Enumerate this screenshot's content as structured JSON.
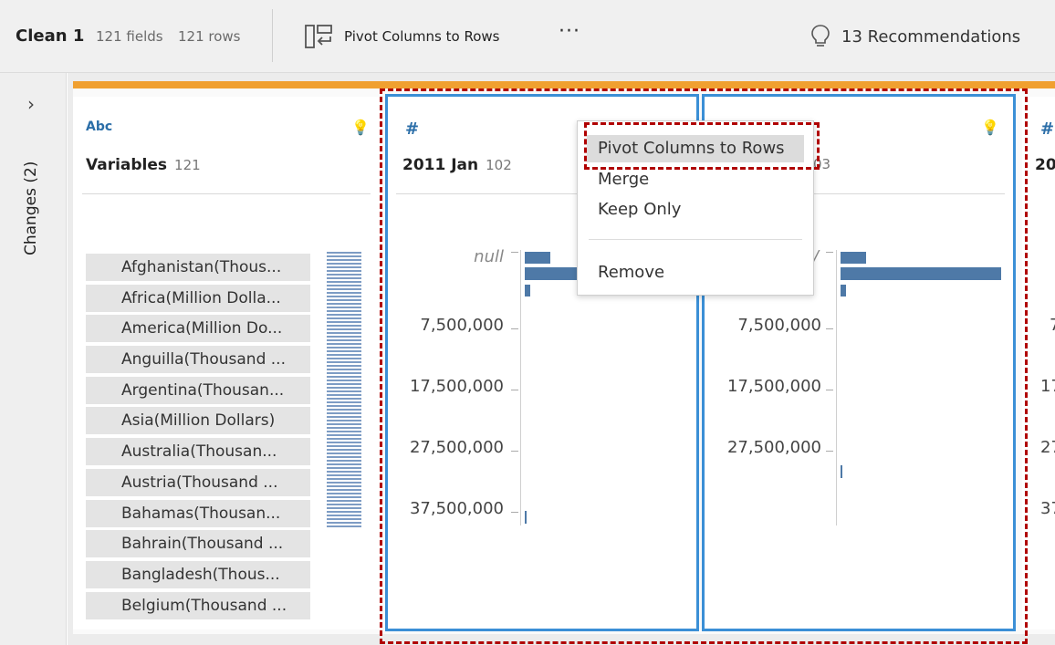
{
  "toolbar": {
    "title": "Clean 1",
    "fields": "121 fields",
    "rows": "121 rows",
    "pivot_label": "Pivot Columns to Rows",
    "more": "···",
    "recommendations": "13 Recommendations"
  },
  "sidebar": {
    "chevron": "›",
    "changes": "Changes (2)"
  },
  "variables_card": {
    "type": "Abc",
    "name": "Variables",
    "count": "121",
    "items": [
      "Afghanistan(Thous...",
      "Africa(Million Dolla...",
      "America(Million Do...",
      "Anguilla(Thousand ...",
      "Argentina(Thousan...",
      "Asia(Million Dollars)",
      "Australia(Thousan...",
      "Austria(Thousand ...",
      "Bahamas(Thousan...",
      "Bahrain(Thousand ...",
      "Bangladesh(Thous...",
      "Belgium(Thousand ..."
    ]
  },
  "col1": {
    "type": "#",
    "name": "2011 Jan",
    "count": "102",
    "null_label": "null",
    "axis": [
      "7,500,000",
      "17,500,000",
      "27,500,000",
      "37,500,000"
    ]
  },
  "col2": {
    "type": "#",
    "count_partial": "03",
    "null_label_partial": "/",
    "axis": [
      "7,500,000",
      "17,500,000",
      "27,500,000"
    ]
  },
  "col3": {
    "type": "#",
    "name_partial": "20",
    "axis_partial": [
      "7",
      "17",
      "27",
      "37"
    ]
  },
  "context_menu": {
    "items": [
      "Pivot Columns to Rows",
      "Merge",
      "Keep Only",
      "Remove"
    ]
  },
  "colors": {
    "accent_orange": "#f0a030",
    "selection_blue": "#3b8fd6",
    "highlight_red": "#b00000",
    "bar_blue": "#4e79a7"
  }
}
